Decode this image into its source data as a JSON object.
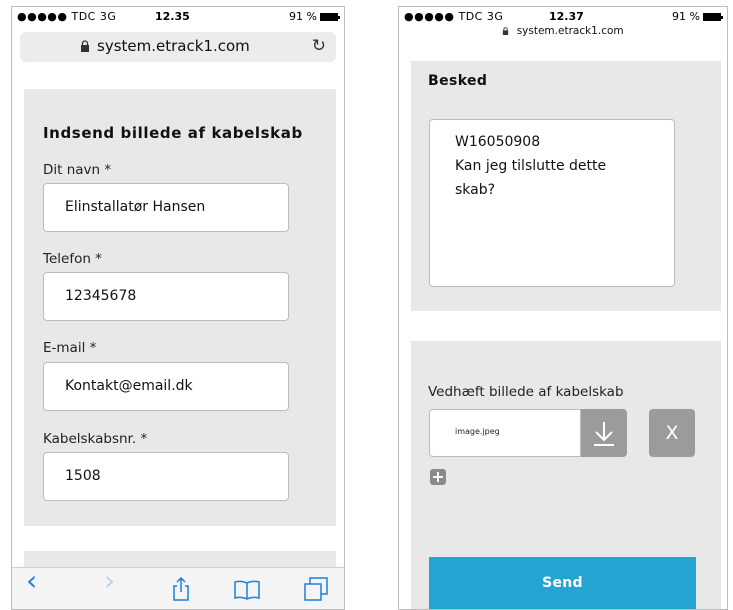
{
  "left_screen": {
    "status": {
      "signal": "●●●●● TDC  3G",
      "time": "12.35",
      "battery": "91 %"
    },
    "address_bar": {
      "url": "system.etrack1.com"
    },
    "form": {
      "title": "Indsend billede af kabelskab",
      "fields": [
        {
          "label": "Dit navn *",
          "value": "Elinstallatør Hansen"
        },
        {
          "label": "Telefon *",
          "value": "12345678"
        },
        {
          "label": "E-mail *",
          "value": "Kontakt@email.dk"
        },
        {
          "label": "Kabelskabsnr. *",
          "value": "1508"
        }
      ]
    },
    "toolbar": {
      "back": "‹",
      "forward": "›"
    }
  },
  "right_screen": {
    "status": {
      "signal": "●●●●● TDC  3G",
      "time": "12.37",
      "battery": "91 %"
    },
    "address_bar": {
      "url": "system.etrack1.com"
    },
    "message": {
      "label": "Besked",
      "lines": [
        "W16050908",
        "Kan jeg tilslutte dette",
        "skab?"
      ]
    },
    "attachment": {
      "label": "Vedhæft billede af kabelskab",
      "filename": "image.jpeg",
      "clear_label": "X",
      "add_label": "+"
    },
    "send_label": "Send"
  },
  "colors": {
    "accent": "#25a4d2",
    "ios_blue": "#1a7fe0",
    "card_bg": "#e8e8e8",
    "button_gray": "#9b9b9b"
  }
}
